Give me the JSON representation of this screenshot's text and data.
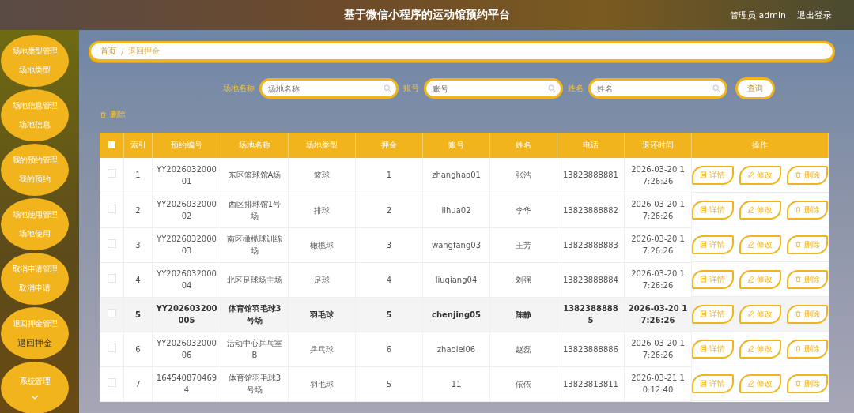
{
  "header": {
    "title": "基于微信小程序的运动馆预约平台",
    "user": "管理员 admin",
    "logout": "退出登录"
  },
  "sidebar": [
    {
      "title": "场地类型管理",
      "expanded": true,
      "children": [
        {
          "label": "场地类型",
          "selected": false
        }
      ]
    },
    {
      "title": "场地信息管理",
      "expanded": true,
      "children": [
        {
          "label": "场地信息",
          "selected": false
        }
      ]
    },
    {
      "title": "我的预约管理",
      "expanded": true,
      "children": [
        {
          "label": "我的预约",
          "selected": false
        }
      ]
    },
    {
      "title": "场地使用管理",
      "expanded": true,
      "children": [
        {
          "label": "场地使用",
          "selected": false
        }
      ]
    },
    {
      "title": "取消申请管理",
      "expanded": true,
      "children": [
        {
          "label": "取消申请",
          "selected": false
        }
      ]
    },
    {
      "title": "退回押金管理",
      "expanded": true,
      "children": [
        {
          "label": "退回押金",
          "selected": true
        }
      ]
    },
    {
      "title": "系统管理",
      "expanded": false
    }
  ],
  "breadcrumb": [
    "首页",
    "/",
    "退回押金"
  ],
  "search": {
    "fields": [
      {
        "label": "场地名称",
        "placeholder": "场地名称"
      },
      {
        "label": "账号",
        "placeholder": "账号"
      },
      {
        "label": "姓名",
        "placeholder": "姓名"
      }
    ],
    "button": "查询"
  },
  "delete_button": "删除",
  "table": {
    "select_all": {
      "checked": false
    },
    "columns": [
      "索引",
      "预约编号",
      "场地名称",
      "场地类型",
      "押金",
      "账号",
      "姓名",
      "电话",
      "退还时间",
      "操作"
    ],
    "rows": [
      {
        "checked": false,
        "highlighted": false,
        "cells": [
          "1",
          "YY202603200001",
          "东区篮球馆A场",
          "篮球",
          "1",
          "zhanghao01",
          "张浩",
          "13823888881",
          "2026-03-20 17:26:26"
        ],
        "actions": [
          "详情",
          "修改",
          "删除"
        ]
      },
      {
        "checked": false,
        "highlighted": false,
        "cells": [
          "2",
          "YY202603200002",
          "西区排球馆1号场",
          "排球",
          "2",
          "lihua02",
          "李华",
          "13823888882",
          "2026-03-20 17:26:26"
        ],
        "actions": [
          "详情",
          "修改",
          "删除"
        ]
      },
      {
        "checked": false,
        "highlighted": false,
        "cells": [
          "3",
          "YY202603200003",
          "南区橄榄球训练场",
          "橄榄球",
          "3",
          "wangfang03",
          "王芳",
          "13823888883",
          "2026-03-20 17:26:26"
        ],
        "actions": [
          "详情",
          "修改",
          "删除"
        ]
      },
      {
        "checked": false,
        "highlighted": false,
        "cells": [
          "4",
          "YY202603200004",
          "北区足球场主场",
          "足球",
          "4",
          "liuqiang04",
          "刘强",
          "13823888884",
          "2026-03-20 17:26:26"
        ],
        "actions": [
          "详情",
          "修改",
          "删除"
        ]
      },
      {
        "checked": false,
        "highlighted": true,
        "cells": [
          "5",
          "YY202603200005",
          "体育馆羽毛球3号场",
          "羽毛球",
          "5",
          "chenjing05",
          "陈静",
          "13823888885",
          "2026-03-20 17:26:26"
        ],
        "actions": [
          "详情",
          "修改",
          "删除"
        ]
      },
      {
        "checked": false,
        "highlighted": false,
        "cells": [
          "6",
          "YY202603200006",
          "活动中心乒乓室B",
          "乒乓球",
          "6",
          "zhaolei06",
          "赵磊",
          "13823888886",
          "2026-03-20 17:26:26"
        ],
        "actions": [
          "详情",
          "修改",
          "删除"
        ]
      },
      {
        "checked": false,
        "highlighted": false,
        "cells": [
          "7",
          "1645408704694",
          "体育馆羽毛球3号场",
          "羽毛球",
          "5",
          "11",
          "依依",
          "13823813811",
          "2026-03-21 10:12:40"
        ],
        "actions": [
          "详情",
          "修改",
          "删除"
        ]
      }
    ]
  }
}
